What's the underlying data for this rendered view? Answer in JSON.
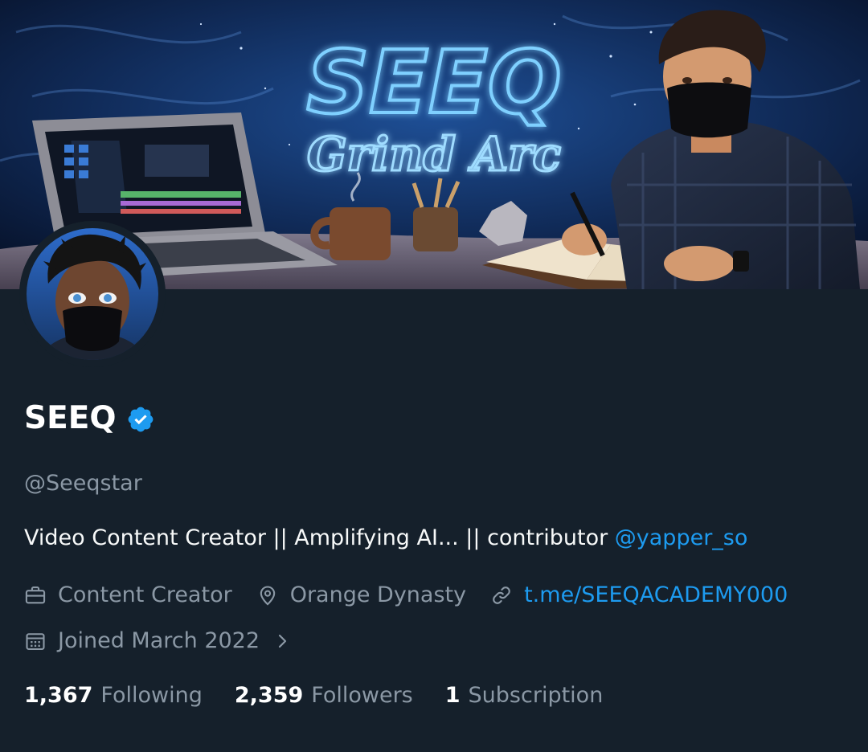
{
  "banner": {
    "title_main": "SEEQ",
    "title_sub": "Grind Arc"
  },
  "profile": {
    "display_name": "SEEQ",
    "handle": "@Seeqstar",
    "bio_text": "Video Content Creator || Amplifying AI... || contributor ",
    "bio_mention": "@yapper_so",
    "category": "Content Creator",
    "location": "Orange Dynasty",
    "website": "t.me/SEEQACADEMY000",
    "joined": "Joined March 2022"
  },
  "stats": {
    "following_count": "1,367",
    "following_label": "Following",
    "followers_count": "2,359",
    "followers_label": "Followers",
    "subscription_count": "1",
    "subscription_label": "Subscription"
  },
  "icons": {
    "verified": "verified-badge-icon",
    "category": "briefcase-icon",
    "location": "location-pin-icon",
    "website": "link-icon",
    "joined": "calendar-icon",
    "more": "chevron-right-icon"
  },
  "colors": {
    "background": "#15202b",
    "accent": "#1d9bf0",
    "text_primary": "#ffffff",
    "text_secondary": "#8b98a5"
  }
}
